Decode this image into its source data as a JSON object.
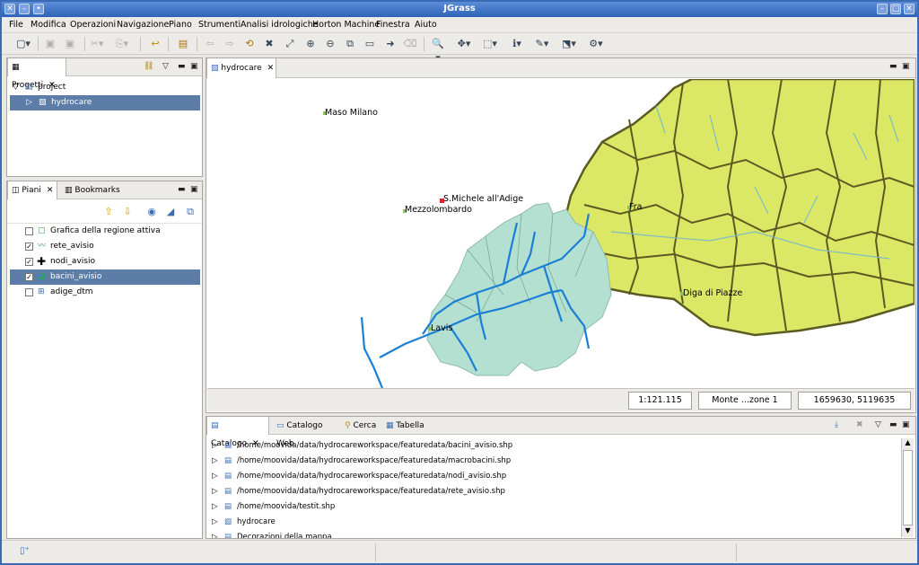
{
  "window": {
    "title": "JGrass"
  },
  "menu": [
    "File",
    "Modifica",
    "Operazioni",
    "Navigazione",
    "Piano",
    "Strumenti",
    "Analisi idrologiche",
    "Horton Machine",
    "Finestra",
    "Aiuto"
  ],
  "projects_panel": {
    "tab_label": "Progetti",
    "tree": [
      {
        "label": "project"
      },
      {
        "label": "hydrocare"
      }
    ]
  },
  "layers_panel": {
    "tabs": [
      "Piani",
      "Bookmarks"
    ],
    "layers": [
      {
        "label": "Grafica della regione attiva",
        "checked": false
      },
      {
        "label": "rete_avisio",
        "checked": true
      },
      {
        "label": "nodi_avisio",
        "checked": true
      },
      {
        "label": "bacini_avisio",
        "checked": true
      },
      {
        "label": "adige_dtm",
        "checked": false
      }
    ]
  },
  "map_editor": {
    "tab_label": "hydrocare",
    "places": [
      "Maso Milano",
      "S.Michele all'Adige",
      "Mezzolombardo",
      "Fra",
      "Diga di Piazze",
      "Lavis"
    ],
    "scale": "1:121.115",
    "crs": "Monte ...zone 1",
    "coordinates": "1659630, 5119635",
    "colors": {
      "basin_fill": "#dbe865",
      "basin_stroke": "#5b5a22",
      "subbasin_fill": "#b3e0d1",
      "river": "#1b7fd6"
    }
  },
  "catalog_panel": {
    "tabs": [
      "Catalogo",
      "Catalogo Web",
      "Cerca",
      "Tabella"
    ],
    "items": [
      "/home/moovida/data/hydrocareworkspace/featuredata/bacini_avisio.shp",
      "/home/moovida/data/hydrocareworkspace/featuredata/macrobacini.shp",
      "/home/moovida/data/hydrocareworkspace/featuredata/nodi_avisio.shp",
      "/home/moovida/data/hydrocareworkspace/featuredata/rete_avisio.shp",
      "/home/moovida/testit.shp",
      "hydrocare",
      "Decorazioni della mappa"
    ]
  }
}
